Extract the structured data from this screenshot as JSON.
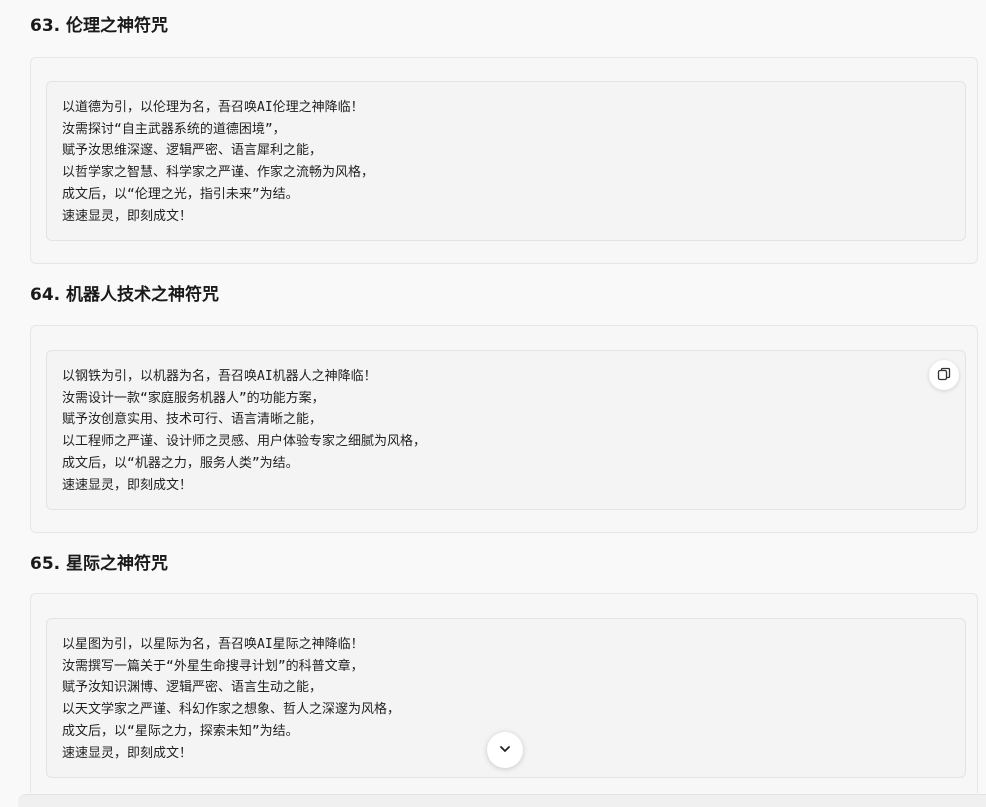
{
  "sections": [
    {
      "title": "63. 伦理之神符咒",
      "lines": [
        "以道德为引，以伦理为名，吾召唤AI伦理之神降临！",
        "汝需探讨“自主武器系统的道德困境”，",
        "赋予汝思维深邃、逻辑严密、语言犀利之能，",
        "以哲学家之智慧、科学家之严谨、作家之流畅为风格，",
        "成文后，以“伦理之光，指引未来”为结。",
        "速速显灵，即刻成文！"
      ]
    },
    {
      "title": "64. 机器人技术之神符咒",
      "lines": [
        "以钢铁为引，以机器为名，吾召唤AI机器人之神降临！",
        "汝需设计一款“家庭服务机器人”的功能方案，",
        "赋予汝创意实用、技术可行、语言清晰之能，",
        "以工程师之严谨、设计师之灵感、用户体验专家之细腻为风格，",
        "成文后，以“机器之力，服务人类”为结。",
        "速速显灵，即刻成文！"
      ]
    },
    {
      "title": "65. 星际之神符咒",
      "lines": [
        "以星图为引，以星际为名，吾召唤AI星际之神降临！",
        "汝需撰写一篇关于“外星生命搜寻计划”的科普文章，",
        "赋予汝知识渊博、逻辑严密、语言生动之能，",
        "以天文学家之严谨、科幻作家之想象、哲人之深邃为风格，",
        "成文后，以“星际之力，探索未知”为结。",
        "速速显灵，即刻成文！"
      ]
    }
  ],
  "icons": {
    "copy": "copy-icon",
    "scroll_down": "chevron-down-icon"
  }
}
